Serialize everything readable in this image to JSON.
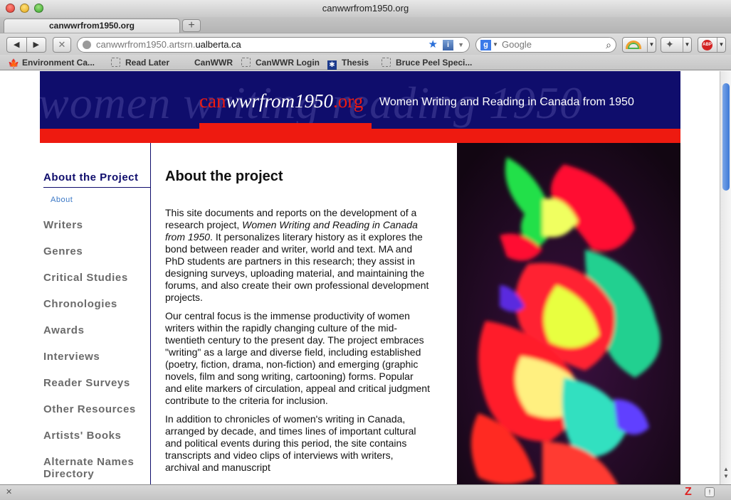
{
  "window": {
    "title": "canwwrfrom1950.org"
  },
  "tabs": [
    {
      "label": "canwwrfrom1950.org",
      "active": true
    }
  ],
  "new_tab_symbol": "+",
  "nav": {
    "back_icon": "◀",
    "forward_icon": "▶",
    "stop_icon": "✕"
  },
  "url": {
    "prefix": "canwwrfrom1950.artsrn.",
    "host": "ualberta.ca"
  },
  "search": {
    "engine": "Google",
    "placeholder": "Google"
  },
  "bookmarks": [
    {
      "label": "Environment Ca...",
      "icon": "maple-leaf-icon"
    },
    {
      "label": "Read Later",
      "icon": "bookmark-icon"
    },
    {
      "label": "CanWWR",
      "icon": "none"
    },
    {
      "label": "CanWWR Login",
      "icon": "bookmark-icon"
    },
    {
      "label": "Thesis",
      "icon": "thesis-icon"
    },
    {
      "label": "Bruce Peel Speci...",
      "icon": "bookmark-icon"
    }
  ],
  "site": {
    "watermark": "women writing reading 1950",
    "logo": {
      "part1": "can",
      "part2": "wwrfrom1950",
      "part3": ".org"
    },
    "subtitle": "Women Writing and Reading in Canada from 1950",
    "colors": {
      "navy": "#0f0d6c",
      "red": "#ee1a10",
      "nav_text": "#6a6a6a",
      "link": "#3b78c6"
    }
  },
  "sidebar": {
    "heading": "About the Project",
    "sub_item": "About",
    "items": [
      "Writers",
      "Genres",
      "Critical Studies",
      "Chronologies",
      "Awards",
      "Interviews",
      "Reader Surveys",
      "Other Resources",
      "Artists' Books",
      "Alternate Names Directory"
    ]
  },
  "main": {
    "title": "About the project",
    "p1": {
      "before": "This site documents and reports on the development of a research project, ",
      "italic": "Women Writing and Reading in Canada from 1950",
      "after": ". It personalizes literary history as it explores the bond between reader and writer, world and text. MA and PhD students are partners in this research; they assist in designing surveys, uploading material, and maintaining the forums, and also create their own professional development projects."
    },
    "p2": "Our central focus is the immense productivity of women writers within the rapidly changing culture of the mid-twentieth century to the present day. The project embraces \"writing\" as a large and diverse field, including established (poetry, fiction, drama, non-fiction) and emerging (graphic novels, film and song writing, cartooning) forms. Popular and elite markers of circulation, appeal and critical judgment contribute to the criteria for inclusion.",
    "p3": "In addition to chronicles of women's writing in Canada, arranged by decade, and times lines of important cultural and political events during this period, the site contains transcripts and video clips of interviews with writers, archival and manuscript"
  },
  "status": {
    "zotero": "Z",
    "info": "!"
  }
}
